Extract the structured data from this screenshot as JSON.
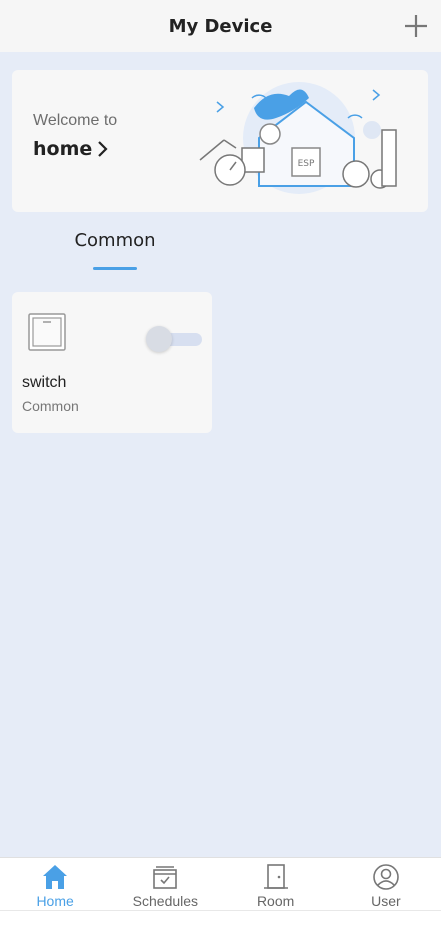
{
  "header": {
    "title": "My Device",
    "add_icon": "plus-icon"
  },
  "banner": {
    "welcome": "Welcome to",
    "home": "home",
    "chevron_icon": "chevron-right-icon",
    "illustration_text": "ESP"
  },
  "tabs": [
    {
      "label": "Common",
      "active": true
    }
  ],
  "devices": [
    {
      "name": "switch",
      "room": "Common",
      "icon": "switch-icon",
      "power_on": false
    }
  ],
  "nav": [
    {
      "label": "Home",
      "icon": "home-icon",
      "active": true
    },
    {
      "label": "Schedules",
      "icon": "calendar-check-icon",
      "active": false
    },
    {
      "label": "Room",
      "icon": "door-icon",
      "active": false
    },
    {
      "label": "User",
      "icon": "user-icon",
      "active": false
    }
  ],
  "colors": {
    "accent": "#4aa0e6",
    "background": "#e6ecf7",
    "card": "#f7f7f7"
  }
}
